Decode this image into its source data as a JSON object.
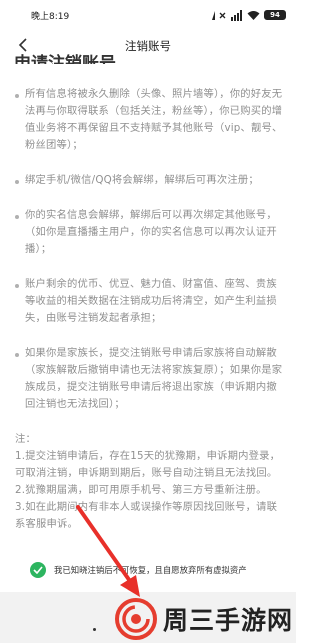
{
  "status_bar": {
    "time": "晚上8:19",
    "battery": "94"
  },
  "nav": {
    "title": "注销账号"
  },
  "heading_partial": "申请注销账号",
  "terms": [
    "所有信息将被永久删除（头像、照片墙等），你的好友无法再与你取得联系（包括关注，粉丝等），你已购买的增值业务将不再保留且不支持赋予其他账号（vip、靓号、粉丝团等）；",
    "绑定手机/微信/QQ将会解绑，解绑后可再次注册；",
    "你的实名信息会解绑，解绑后可以再次绑定其他账号，（如你是直播播主用户，你的实名信息可以再次认证开播）；",
    "账户剩余的优币、优豆、魅力值、财富值、座驾、贵族等收益的相关数据在注销成功后将清空，如产生利益损失，由账号注销发起者承担；",
    "如果你是家族长，提交注销账号申请后家族将自动解散（家族解散后撤销申请也无法将家族复原）；如果你是家族成员，提交注销账号申请后将退出家族（申诉期内撤回注销也无法找回）；"
  ],
  "notes": {
    "title": "注：",
    "items": [
      "1.提交注销申请后，存在15天的犹豫期，申诉期内登录，可取消注销，申诉期到期后，账号自动注销且无法找回。",
      "2.犹豫期届满，即可用原手机号、第三方号重新注册。",
      "3.如在此期间内有非本人或误操作等原因找回账号，请联系客服申诉。"
    ]
  },
  "consent": {
    "text": "我已知晓注销后不可恢复，且自愿放弃所有虚拟资产"
  },
  "watermark": {
    "text": "周三手游网"
  },
  "colors": {
    "check_green": "#2db560",
    "arrow_red": "#e8302a",
    "logo_red": "#e53d2f"
  }
}
